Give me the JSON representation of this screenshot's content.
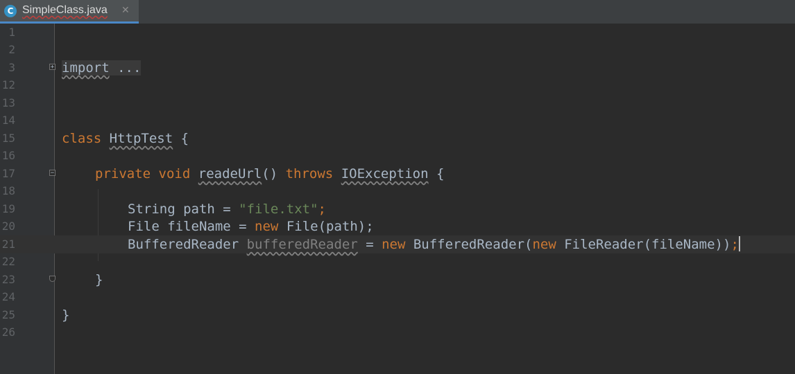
{
  "tab": {
    "icon_letter": "C",
    "title": "SimpleClass.java",
    "close": "✕"
  },
  "editor": {
    "current_line": "21",
    "lines": [
      {
        "num": "1"
      },
      {
        "num": "2"
      },
      {
        "num": "3",
        "import_kw": "import",
        "import_folded": " ..."
      },
      {
        "num": "12"
      },
      {
        "num": "13"
      },
      {
        "num": "14"
      },
      {
        "num": "15",
        "class_kw": "class",
        "class_name": "HttpTest",
        "brace": " {"
      },
      {
        "num": "16"
      },
      {
        "num": "17",
        "private_kw": "private",
        "void_kw": "void",
        "method_name": "readeUrl",
        "parens": "()",
        "throws_kw": "throws",
        "exception": "IOException",
        "brace": " {"
      },
      {
        "num": "18"
      },
      {
        "num": "19",
        "type": "String",
        "var": " path = ",
        "string": "\"file.txt\"",
        "semi": ";"
      },
      {
        "num": "20",
        "type": "File",
        "var": " fileName = ",
        "new_kw": "new",
        "rest": " File(path);"
      },
      {
        "num": "21",
        "type": "BufferedReader",
        "var": "bufferedReader",
        "eq": " = ",
        "new_kw": "new",
        "ctor": " BufferedReader(",
        "new_kw2": "new",
        "rest": " FileReader(fileName))",
        "semi": ";"
      },
      {
        "num": "22"
      },
      {
        "num": "23",
        "brace": "}"
      },
      {
        "num": "24"
      },
      {
        "num": "25",
        "brace": "}"
      },
      {
        "num": "26"
      }
    ]
  }
}
